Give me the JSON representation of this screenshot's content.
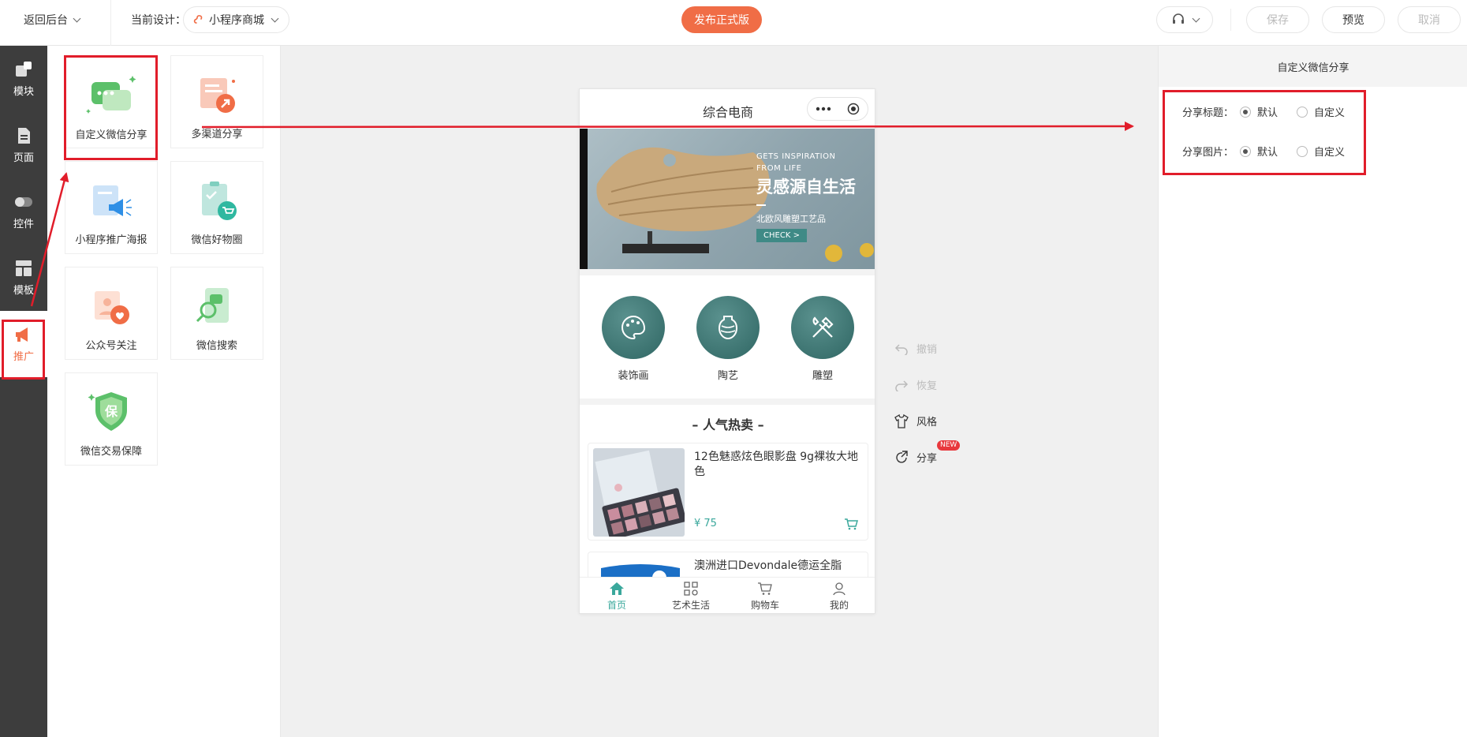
{
  "topbar": {
    "back_label": "返回后台",
    "current_design_label": "当前设计：",
    "current_design_value": "小程序商城",
    "publish_label": "发布正式版",
    "save_label": "保存",
    "preview_label": "预览",
    "cancel_label": "取消"
  },
  "leftnav": {
    "items": [
      {
        "label": "模块",
        "icon": "module-icon"
      },
      {
        "label": "页面",
        "icon": "page-icon"
      },
      {
        "label": "控件",
        "icon": "toggle-icon"
      },
      {
        "label": "模板",
        "icon": "template-icon"
      },
      {
        "label": "推广",
        "icon": "megaphone-icon"
      }
    ]
  },
  "promo_cards": [
    {
      "label": "自定义微信分享"
    },
    {
      "label": "多渠道分享"
    },
    {
      "label": "小程序推广海报"
    },
    {
      "label": "微信好物圈"
    },
    {
      "label": "公众号关注"
    },
    {
      "label": "微信搜索"
    },
    {
      "label": "微信交易保障"
    }
  ],
  "phone": {
    "title": "综合电商",
    "banner": {
      "line1": "GETS INSPIRATION",
      "line2": "FROM LIFE",
      "headline": "灵感源自生活",
      "sub": "北欧风雕塑工艺品",
      "cta": "CHECK >"
    },
    "categories": [
      {
        "label": "装饰画"
      },
      {
        "label": "陶艺"
      },
      {
        "label": "雕塑"
      }
    ],
    "section_title": "–  人气热卖  –",
    "products": [
      {
        "name": "12色魅惑炫色眼影盘 9g裸妆大地色",
        "price": "¥ 75"
      },
      {
        "name": "澳洲进口Devondale德运全脂",
        "price": ""
      }
    ],
    "tabs": [
      {
        "label": "首页"
      },
      {
        "label": "艺术生活"
      },
      {
        "label": "购物车"
      },
      {
        "label": "我的"
      }
    ]
  },
  "tools": {
    "undo": "撤销",
    "redo": "恢复",
    "style": "风格",
    "share": "分享",
    "new_badge": "NEW"
  },
  "rightpanel": {
    "title": "自定义微信分享",
    "share_title_label": "分享标题：",
    "share_image_label": "分享图片：",
    "opt_default": "默认",
    "opt_custom": "自定义"
  },
  "colors": {
    "accent": "#f06d46",
    "teal": "#3aa89c",
    "annotation_red": "#e11d2a",
    "nav_bg": "#3d3d3d"
  }
}
